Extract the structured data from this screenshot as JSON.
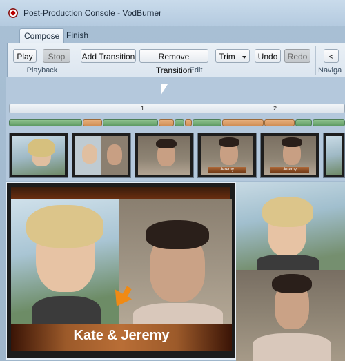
{
  "window": {
    "title": "Post-Production Console - VodBurner"
  },
  "tabs": [
    {
      "label": "Compose",
      "active": true
    },
    {
      "label": "Finish",
      "active": false
    }
  ],
  "toolbar": {
    "play": "Play",
    "stop": "Stop",
    "add_transition": "Add Transition",
    "remove_transition": "Remove Transition",
    "trim": "Trim",
    "undo": "Undo",
    "redo": "Redo",
    "prev": "<",
    "groups": {
      "playback": "Playback",
      "edit": "Edit",
      "navigate": "Naviga"
    }
  },
  "timeline": {
    "ruler_labels": [
      "1",
      "2"
    ],
    "thumb_labels": [
      "Jeremy",
      "Jeremy"
    ]
  },
  "preview": {
    "caption": "Kate & Jeremy"
  },
  "colors": {
    "accent_orange": "#f08a14",
    "clip_green": "#6aa56e",
    "clip_orange": "#d99a63"
  }
}
